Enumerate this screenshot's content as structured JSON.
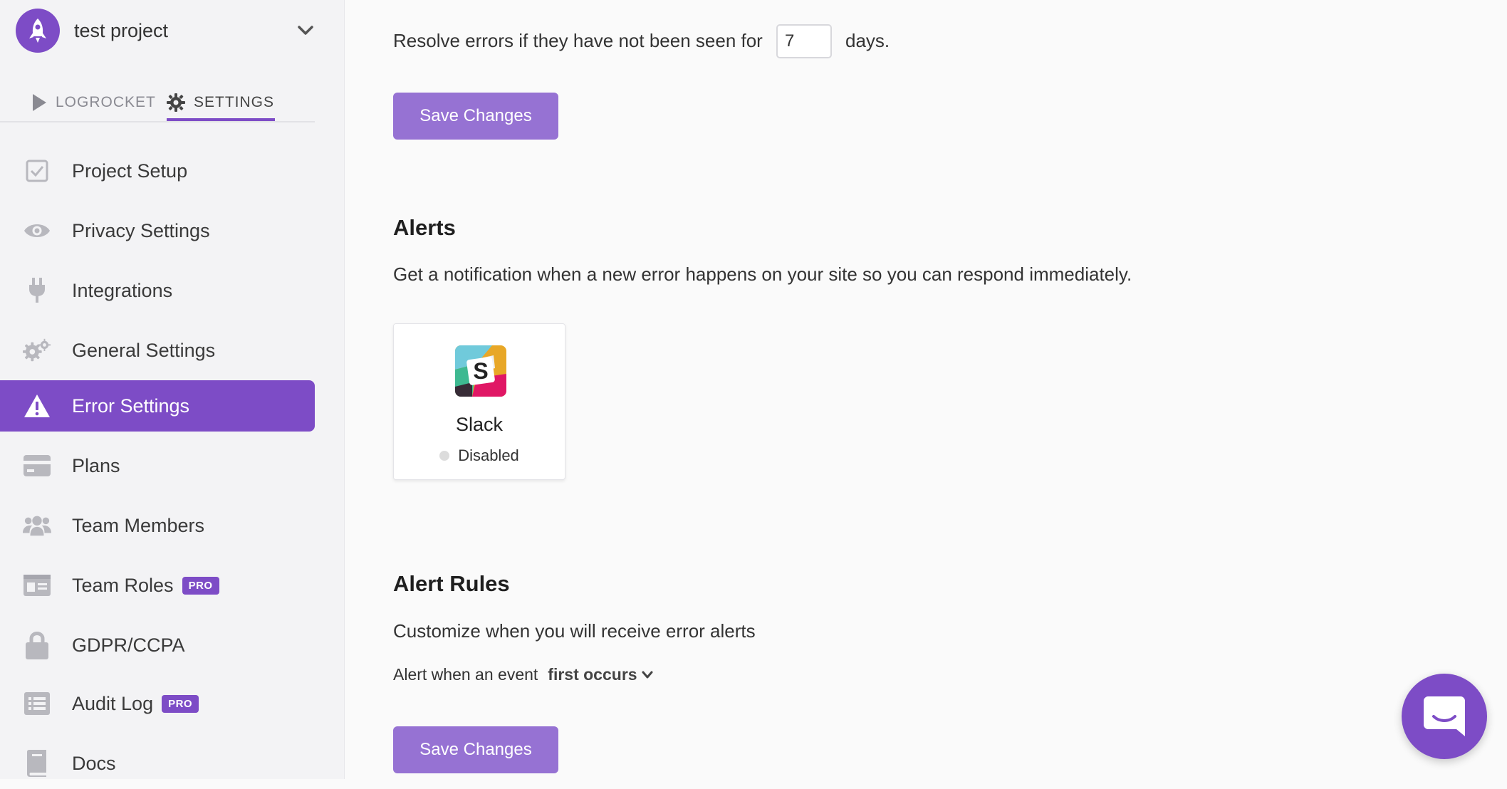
{
  "project": {
    "name": "test project",
    "avatar_icon": "rocket-icon"
  },
  "tabs": [
    {
      "label": "LOGROCKET",
      "icon": "play-icon"
    },
    {
      "label": "SETTINGS",
      "icon": "gear-icon",
      "active": true
    }
  ],
  "sidebar": {
    "items": [
      {
        "label": "Project Setup",
        "icon": "checkbox-icon"
      },
      {
        "label": "Privacy Settings",
        "icon": "eye-icon"
      },
      {
        "label": "Integrations",
        "icon": "plug-icon"
      },
      {
        "label": "General Settings",
        "icon": "gears-icon"
      },
      {
        "label": "Error Settings",
        "icon": "warning-icon",
        "active": true
      },
      {
        "label": "Plans",
        "icon": "credit-card-icon"
      },
      {
        "label": "Team Members",
        "icon": "users-icon"
      },
      {
        "label": "Team Roles",
        "icon": "id-card-icon",
        "badge": "PRO"
      },
      {
        "label": "GDPR/CCPA",
        "icon": "lock-icon"
      },
      {
        "label": "Audit Log",
        "icon": "list-icon",
        "badge": "PRO"
      },
      {
        "label": "Docs",
        "icon": "book-icon"
      }
    ]
  },
  "resolve": {
    "text_before": "Resolve errors if they have not been seen for",
    "value": "7",
    "text_after": "days.",
    "save_label": "Save Changes"
  },
  "alerts": {
    "title": "Alerts",
    "description": "Get a notification when a new error happens on your site so you can respond immediately.",
    "integration": {
      "name": "Slack",
      "status": "Disabled",
      "icon": "slack-logo-icon"
    }
  },
  "alert_rules": {
    "title": "Alert Rules",
    "description": "Customize when you will receive error alerts",
    "rule_prefix": "Alert when an event",
    "rule_value": "first occurs",
    "save_label": "Save Changes"
  },
  "chat": {
    "icon": "chat-icon"
  },
  "colors": {
    "accent": "#7d4cc6",
    "button": "#9672d3",
    "sidebar_bg": "#f3f3f5",
    "main_bg": "#fafafa"
  }
}
